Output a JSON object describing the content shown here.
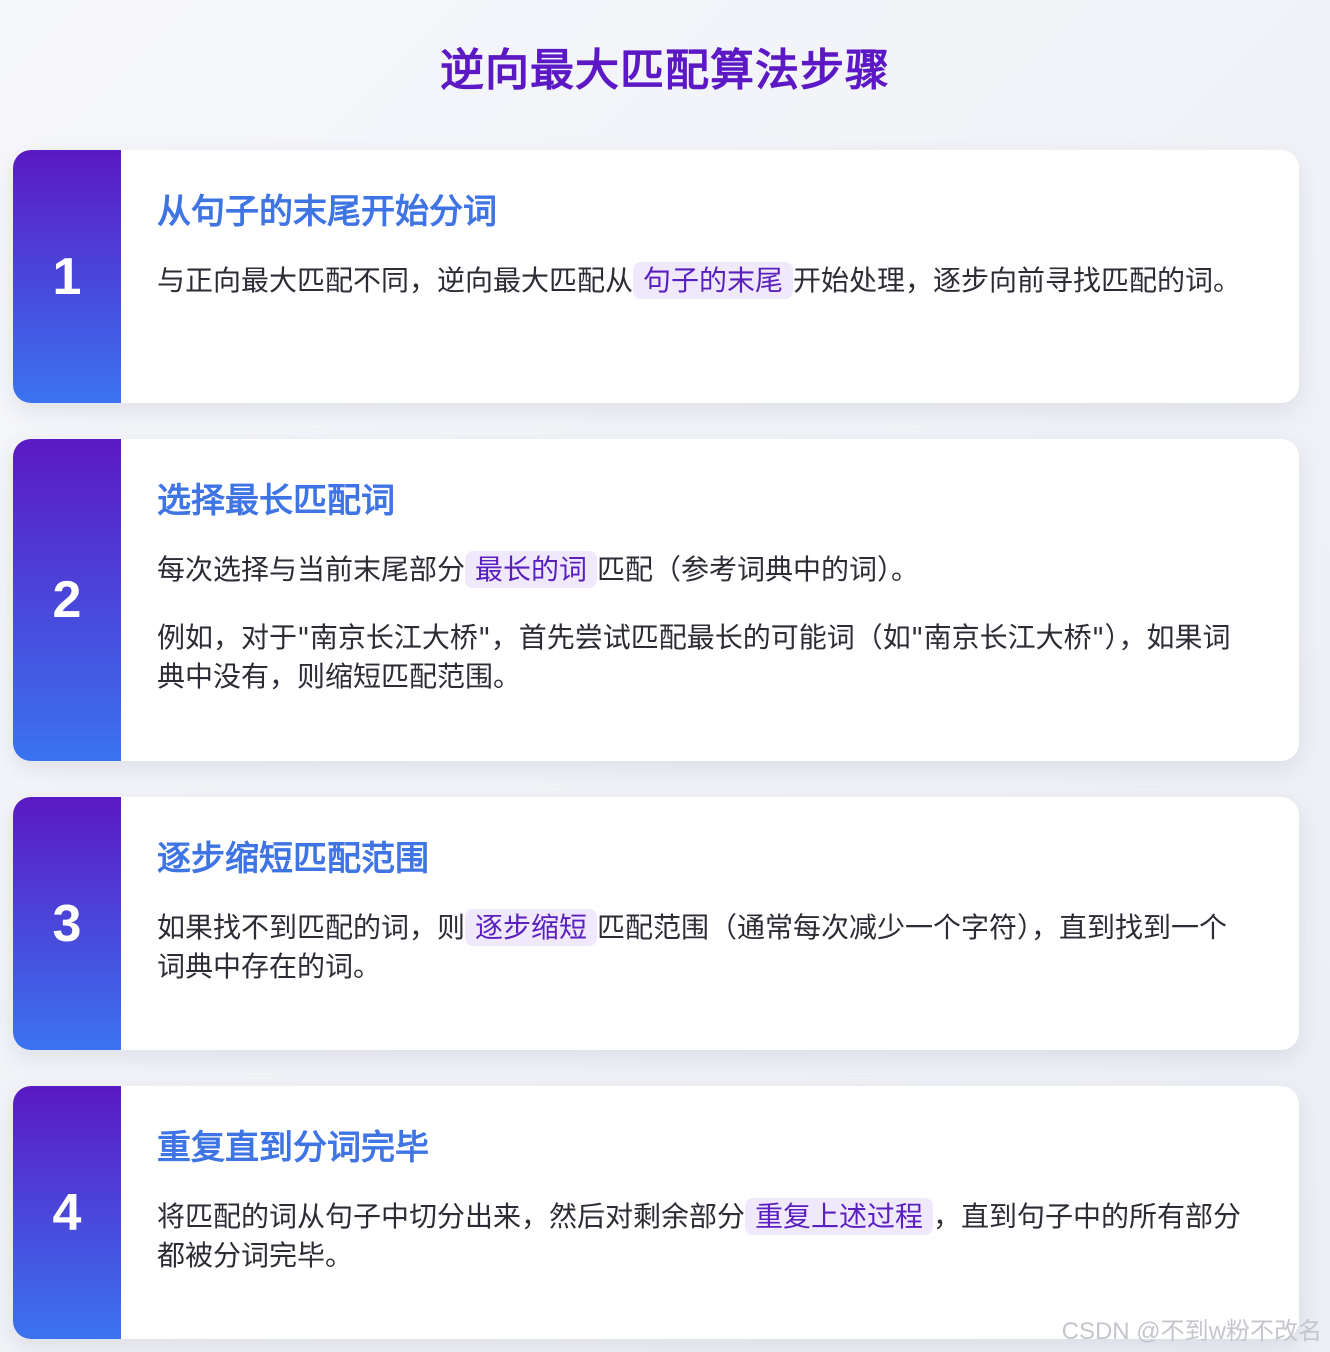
{
  "title": "逆向最大匹配算法步骤",
  "steps": [
    {
      "number": "1",
      "heading": "从句子的末尾开始分词",
      "p1_before": "与正向最大匹配不同，逆向最大匹配从",
      "p1_highlight": "句子的末尾",
      "p1_after": "开始处理，逐步向前寻找匹配的词。"
    },
    {
      "number": "2",
      "heading": "选择最长匹配词",
      "p1_before": "每次选择与当前末尾部分",
      "p1_highlight": "最长的词",
      "p1_after": "匹配（参考词典中的词）。",
      "p2": "例如，对于\"南京长江大桥\"，首先尝试匹配最长的可能词（如\"南京长江大桥\"），如果词典中没有，则缩短匹配范围。"
    },
    {
      "number": "3",
      "heading": "逐步缩短匹配范围",
      "p1_before": "如果找不到匹配的词，则",
      "p1_highlight": "逐步缩短",
      "p1_after": "匹配范围（通常每次减少一个字符），直到找到一个词典中存在的词。"
    },
    {
      "number": "4",
      "heading": "重复直到分词完毕",
      "p1_before": "将匹配的词从句子中切分出来，然后对剩余部分",
      "p1_highlight": "重复上述过程",
      "p1_after": "，直到句子中的所有部分都被分词完毕。"
    }
  ],
  "watermark": "CSDN @不到w粉不改名",
  "colors": {
    "title": "#5b18c4",
    "heading": "#3f74e4",
    "highlight_bg": "#f0e8fb",
    "highlight_text": "#5a1fbf",
    "number_gradient_top": "#5b19c2",
    "number_gradient_bottom": "#3a73f0"
  }
}
